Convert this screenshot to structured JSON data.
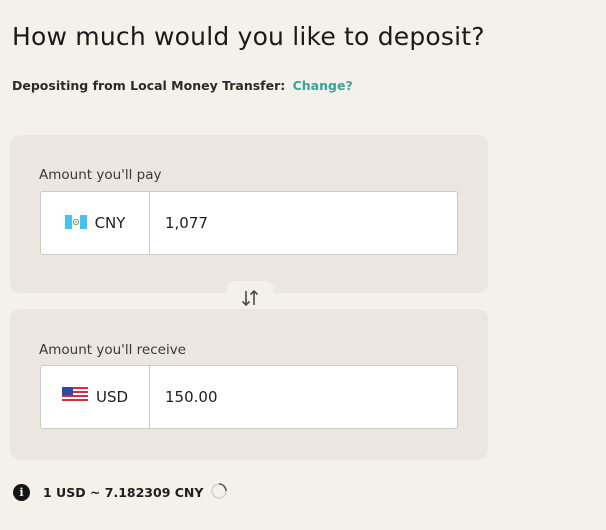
{
  "header": {
    "title": "How much would you like to deposit?",
    "source_prefix": "Depositing from Local Money Transfer:",
    "change_link": "Change?"
  },
  "pay": {
    "label": "Amount you'll pay",
    "currency_code": "CNY",
    "currency_flag": "guatemala-flag-icon",
    "amount": "1,077"
  },
  "swap": {
    "icon": "swap-arrows-icon"
  },
  "receive": {
    "label": "Amount you'll receive",
    "currency_code": "USD",
    "currency_flag": "us-flag-icon",
    "amount": "150.00"
  },
  "rate": {
    "text": "1 USD ~ 7.182309 CNY",
    "info_icon": "info-icon",
    "loading_icon": "spinner-icon"
  },
  "colors": {
    "background": "#f4f0ea",
    "card": "#ebe6df",
    "accent_link": "#3aa39a",
    "text": "#1e1e1e"
  }
}
